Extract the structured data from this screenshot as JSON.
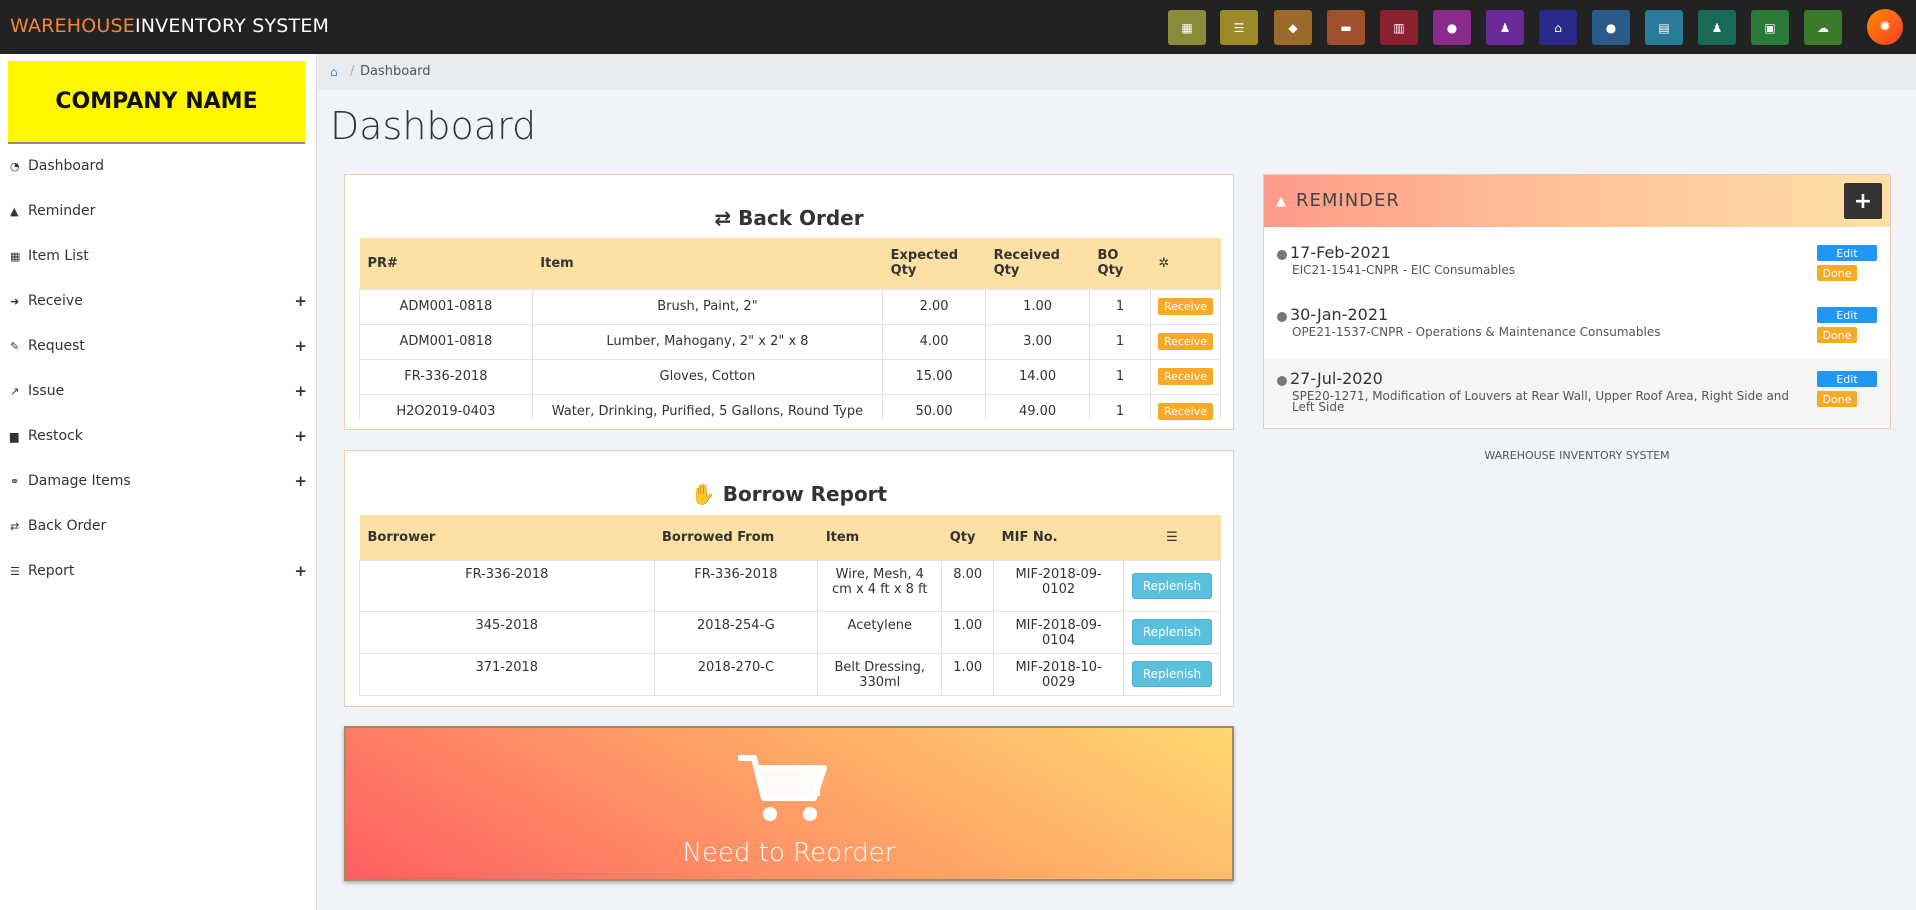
{
  "app": {
    "title_part1": "WAREHOUSE",
    "title_part2": "INVENTORY SYSTEM"
  },
  "toolbar": [
    {
      "icon": "dashboard-icon",
      "color": "#8a8a3a",
      "glyph": "▦"
    },
    {
      "icon": "list-icon",
      "color": "#9a8a2a",
      "glyph": "☰"
    },
    {
      "icon": "tag-icon",
      "color": "#9a6a2a",
      "glyph": "◆"
    },
    {
      "icon": "truck-icon",
      "color": "#a0502a",
      "glyph": "▬"
    },
    {
      "icon": "calculator-icon",
      "color": "#8a2030",
      "glyph": "▥"
    },
    {
      "icon": "circle-icon",
      "color": "#8a2a8a",
      "glyph": "●"
    },
    {
      "icon": "users-icon",
      "color": "#6a2a9a",
      "glyph": "♟"
    },
    {
      "icon": "home-icon",
      "color": "#2a2a8a",
      "glyph": "⌂"
    },
    {
      "icon": "map-marker-icon",
      "color": "#2a5a8a",
      "glyph": "●"
    },
    {
      "icon": "newspaper-icon",
      "color": "#2a7a9a",
      "glyph": "▤"
    },
    {
      "icon": "user-icon",
      "color": "#1a6a5a",
      "glyph": "♟"
    },
    {
      "icon": "file-excel-icon",
      "color": "#2a7a3a",
      "glyph": "▣"
    },
    {
      "icon": "cloud-upload-icon",
      "color": "#3a7a2a",
      "glyph": "☁"
    }
  ],
  "sidebar": {
    "company": "COMPANY NAME",
    "items": [
      {
        "label": "Dashboard",
        "icon": "tachometer-icon",
        "glyph": "◔",
        "expand": false
      },
      {
        "label": "Reminder",
        "icon": "bell-icon",
        "glyph": "▲",
        "expand": false
      },
      {
        "label": "Item List",
        "icon": "calendar-icon",
        "glyph": "▦",
        "expand": false
      },
      {
        "label": "Receive",
        "icon": "sign-in-icon",
        "glyph": "➜",
        "expand": true
      },
      {
        "label": "Request",
        "icon": "edit-icon",
        "glyph": "✎",
        "expand": true
      },
      {
        "label": "Issue",
        "icon": "external-link-icon",
        "glyph": "↗",
        "expand": true
      },
      {
        "label": "Restock",
        "icon": "archive-icon",
        "glyph": "▆",
        "expand": true
      },
      {
        "label": "Damage Items",
        "icon": "chain-broken-icon",
        "glyph": "⚭",
        "expand": true
      },
      {
        "label": "Back Order",
        "icon": "retweet-icon",
        "glyph": "⇄",
        "expand": false
      },
      {
        "label": "Report",
        "icon": "bars-icon",
        "glyph": "☰",
        "expand": true
      }
    ]
  },
  "breadcrumb": {
    "current": "Dashboard"
  },
  "page": {
    "title": "Dashboard"
  },
  "back_order": {
    "title": "Back Order",
    "columns": [
      "PR#",
      "Item",
      "Expected Qty",
      "Received Qty",
      "BO Qty"
    ],
    "action_label": "Receive",
    "rows": [
      [
        "ADM001-0818",
        "Brush, Paint, 2\"",
        "2.00",
        "1.00",
        "1"
      ],
      [
        "ADM001-0818",
        "Lumber, Mahogany, 2\" x 2\" x 8",
        "4.00",
        "3.00",
        "1"
      ],
      [
        "FR-336-2018",
        "Gloves, Cotton",
        "15.00",
        "14.00",
        "1"
      ],
      [
        "H2O2019-0403",
        "Water, Drinking, Purified, 5 Gallons, Round Type",
        "50.00",
        "49.00",
        "1"
      ]
    ]
  },
  "borrow": {
    "title": "Borrow Report",
    "columns": [
      "Borrower",
      "Borrowed From",
      "Item",
      "Qty",
      "MIF No."
    ],
    "action_label": "Replenish",
    "rows": [
      [
        "FR-336-2018",
        "FR-336-2018",
        "Wire, Mesh, 4 cm x 4 ft x 8 ft",
        "8.00",
        "MIF-2018-09-0102"
      ],
      [
        "345-2018",
        "2018-254-G",
        "Acetylene",
        "1.00",
        "MIF-2018-09-0104"
      ],
      [
        "371-2018",
        "2018-270-C",
        "Belt Dressing, 330ml",
        "1.00",
        "MIF-2018-10-0029"
      ]
    ]
  },
  "reorder": {
    "label": "Need to Reorder"
  },
  "reminder": {
    "title": "REMINDER",
    "edit_label": "Edit",
    "done_label": "Done",
    "items": [
      {
        "date": "17-Feb-2021",
        "desc": "EIC21-1541-CNPR - EIC Consumables"
      },
      {
        "date": "30-Jan-2021",
        "desc": "OPE21-1537-CNPR - Operations & Maintenance Consumables"
      },
      {
        "date": "27-Jul-2020",
        "desc": "SPE20-1271, Modification of Louvers at Rear Wall, Upper Roof Area, Right Side and Left Side"
      }
    ]
  },
  "footer": {
    "text": "WAREHOUSE INVENTORY SYSTEM"
  }
}
